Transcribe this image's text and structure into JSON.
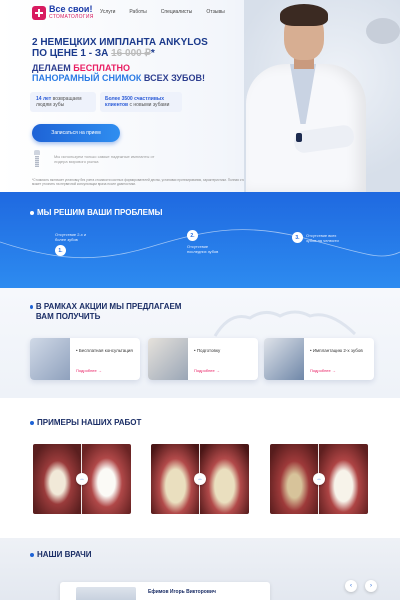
{
  "logo": {
    "title": "Все свои!",
    "subtitle": "СТОМАТОЛОГИЯ"
  },
  "nav": [
    "Услуги",
    "Работы",
    "Специалисты",
    "Отзывы"
  ],
  "hero": {
    "title_line1": "2 немецких импланта ANKYLOS",
    "title_line2_prefix": "по цене 1 - за ",
    "old_price": "16 000 ₽",
    "asterisk": "*",
    "subtitle_prefix": "Делаем ",
    "subtitle_highlight": "бесплатно",
    "subtitle_line2_highlight": "панорамный снимок",
    "subtitle_line2_suffix": " всех зубов!",
    "stat1_bold": "14 лет",
    "stat1_text": " возвращаем людям зубы",
    "stat2_bold": "Более 3500 счастливых клиентов",
    "stat2_text": " с новыми зубами",
    "cta_label": "Записаться на прием",
    "implant_note": "Мы используем только самые надежные импланты от лидера мирового рынка",
    "footnote": "*Стоимость включает установку без учета стоимости костных формирователей десны, установки протезирования, характеристики. Полная стоимость имплантации может уточнить на первичной консультации врача после диагностики."
  },
  "problems": {
    "title": "Мы решим ваши проблемы",
    "steps": [
      {
        "num": "1.",
        "text": "Отсутствие 2-х и более зубов"
      },
      {
        "num": "2.",
        "text": "Отсутствие последних зубов"
      },
      {
        "num": "3.",
        "text": "Отсутствие всех зубов на челюсти"
      }
    ]
  },
  "offers": {
    "title": "В рамках акции мы предлагаем вам получить",
    "cards": [
      {
        "title": "• Бесплатная консультация",
        "link": "Подробнее →"
      },
      {
        "title": "• Подготовку",
        "link": "Подробнее →"
      },
      {
        "title": "• Имплантацию 2-х зубов",
        "link": "Подробнее →"
      }
    ]
  },
  "examples": {
    "title": "Примеры наших работ",
    "handle": "↔"
  },
  "doctors": {
    "title": "Наши врачи",
    "doctor_name": "Ефимов Игорь Викторович",
    "prev": "‹",
    "next": "›"
  },
  "colors": {
    "brand_blue": "#1e63d6",
    "accent_pink": "#e91e63",
    "dark_title": "#1b2e66"
  }
}
